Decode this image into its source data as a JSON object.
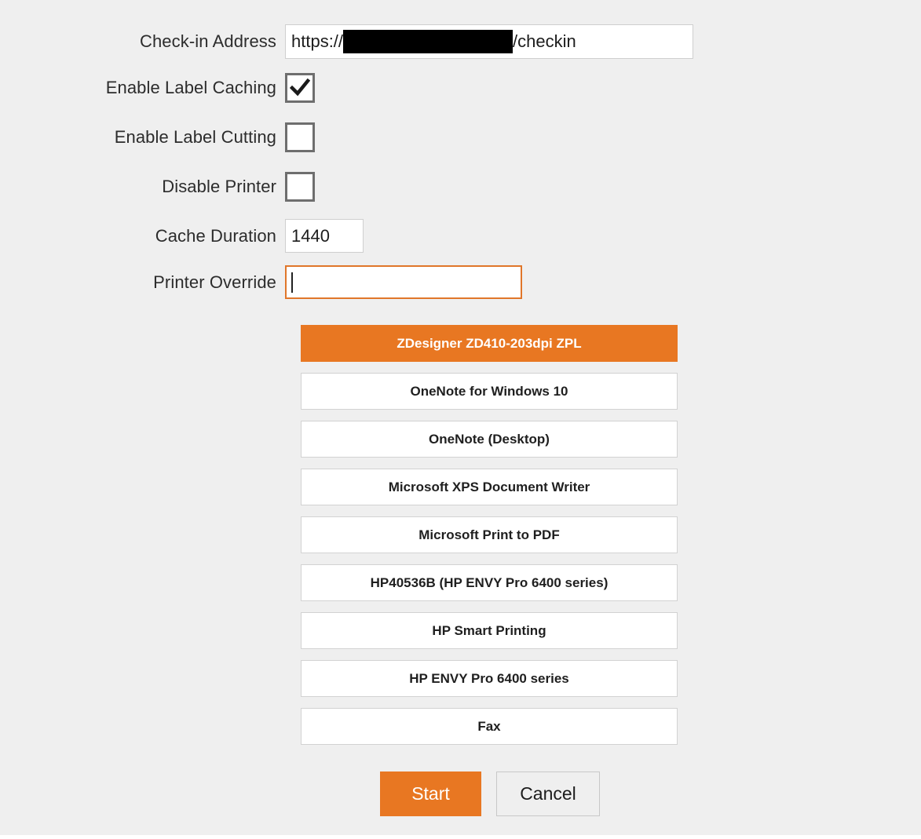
{
  "form": {
    "rows": [
      {
        "label": "Check-in Address",
        "type": "text",
        "value_prefix": "https://",
        "value_suffix": "/checkin",
        "redacted": true
      },
      {
        "label": "Enable Label Caching",
        "type": "checkbox",
        "checked": true
      },
      {
        "label": "Enable Label Cutting",
        "type": "checkbox",
        "checked": false
      },
      {
        "label": "Disable Printer",
        "type": "checkbox",
        "checked": false
      },
      {
        "label": "Cache Duration",
        "type": "text",
        "value": "1440"
      },
      {
        "label": "Printer Override",
        "type": "text",
        "value": "",
        "focused": true
      }
    ]
  },
  "printer_list": {
    "items": [
      {
        "label": "ZDesigner ZD410-203dpi ZPL",
        "selected": true
      },
      {
        "label": "OneNote for Windows 10",
        "selected": false
      },
      {
        "label": "OneNote (Desktop)",
        "selected": false
      },
      {
        "label": "Microsoft XPS Document Writer",
        "selected": false
      },
      {
        "label": "Microsoft Print to PDF",
        "selected": false
      },
      {
        "label": "HP40536B (HP ENVY Pro 6400 series)",
        "selected": false
      },
      {
        "label": "HP Smart Printing",
        "selected": false
      },
      {
        "label": "HP ENVY Pro 6400 series",
        "selected": false
      },
      {
        "label": "Fax",
        "selected": false
      }
    ]
  },
  "actions": {
    "start_label": "Start",
    "cancel_label": "Cancel"
  },
  "colors": {
    "accent": "#e87722",
    "focus_border": "#e0762a",
    "background": "#efefef",
    "text": "#2c2c2c"
  }
}
